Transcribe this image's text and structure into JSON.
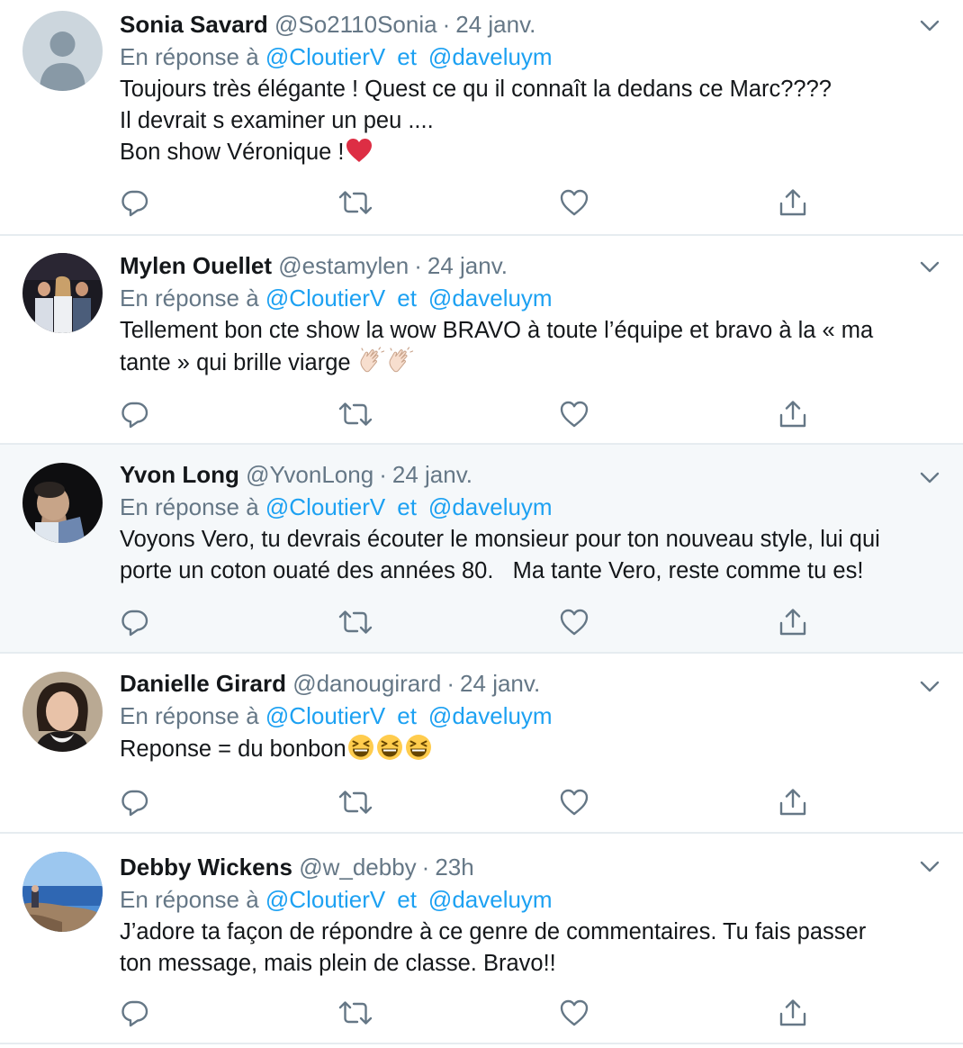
{
  "tweets": [
    {
      "name": "Sonia Savard",
      "handle": "@So2110Sonia",
      "separator": "·",
      "time": "24 janv.",
      "reply_prefix": "En réponse à",
      "mention1": "@CloutierV",
      "conj": "et",
      "mention2": "@daveluym",
      "lines": [
        "Toujours très élégante ! Quest ce qu il connaît la dedans ce Marc????",
        "Il devrait s examiner un peu ....",
        "Bon show Véronique !"
      ],
      "emoji": [
        "red-heart"
      ]
    },
    {
      "name": "Mylen Ouellet",
      "handle": "@estamylen",
      "separator": "·",
      "time": "24 janv.",
      "reply_prefix": "En réponse à",
      "mention1": "@CloutierV",
      "conj": "et",
      "mention2": "@daveluym",
      "lines": [
        "Tellement bon cte show la wow BRAVO à toute l’équipe et bravo à la « ma",
        "tante » qui brille viarge"
      ],
      "emoji": [
        "clapping-hands",
        "clapping-hands"
      ]
    },
    {
      "name": "Yvon Long",
      "handle": "@YvonLong",
      "separator": "·",
      "time": "24 janv.",
      "reply_prefix": "En réponse à",
      "mention1": "@CloutierV",
      "conj": "et",
      "mention2": "@daveluym",
      "lines": [
        "Voyons Vero, tu devrais écouter le monsieur pour ton nouveau style, lui qui",
        "porte un coton ouaté des années 80.   Ma tante Vero, reste comme tu es!"
      ],
      "emoji": []
    },
    {
      "name": "Danielle Girard",
      "handle": "@danougirard",
      "separator": "·",
      "time": "24 janv.",
      "reply_prefix": "En réponse à",
      "mention1": "@CloutierV",
      "conj": "et",
      "mention2": "@daveluym",
      "lines": [
        "Reponse = du bonbon"
      ],
      "emoji": [
        "grinning-squinting-face",
        "grinning-squinting-face",
        "grinning-squinting-face"
      ]
    },
    {
      "name": "Debby Wickens",
      "handle": "@w_debby",
      "separator": "·",
      "time": "23h",
      "reply_prefix": "En réponse à",
      "mention1": "@CloutierV",
      "conj": "et",
      "mention2": "@daveluym",
      "lines": [
        "J’adore ta façon de répondre à ce genre de commentaires. Tu fais passer",
        "ton message, mais plein de classe. Bravo!!"
      ],
      "emoji": []
    }
  ],
  "icons": {
    "reply": "reply-icon",
    "retweet": "retweet-icon",
    "like": "heart-icon",
    "share": "share-icon",
    "menu": "chevron-down-icon"
  },
  "colors": {
    "name": "#14171a",
    "muted": "#657786",
    "link": "#1da1f2",
    "divider": "#e6ecf0",
    "highlight_bg": "#f5f8fa",
    "heart": "#e0245e"
  }
}
